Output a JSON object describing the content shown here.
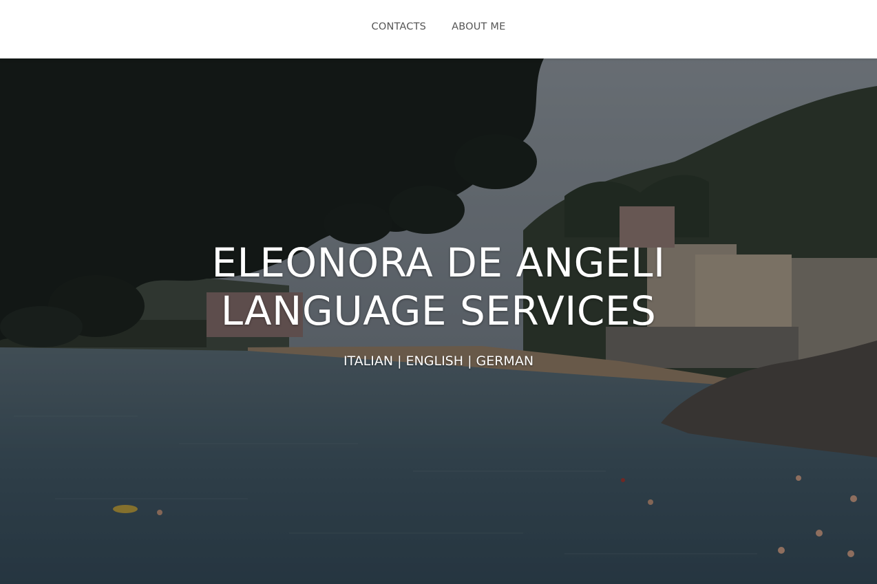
{
  "nav": {
    "items": [
      {
        "label": "CONTACTS"
      },
      {
        "label": "ABOUT ME"
      }
    ]
  },
  "hero": {
    "title_line1": "ELEONORA DE ANGELI",
    "title_line2": "LANGUAGE SERVICES",
    "subtitle": "ITALIAN | ENGLISH | GERMAN",
    "background_image_description": "coastal bay",
    "colors": {
      "sky": "#8a949c",
      "sea": "#3d5866",
      "foliage": "#0f150f",
      "text": "#ffffff"
    }
  }
}
